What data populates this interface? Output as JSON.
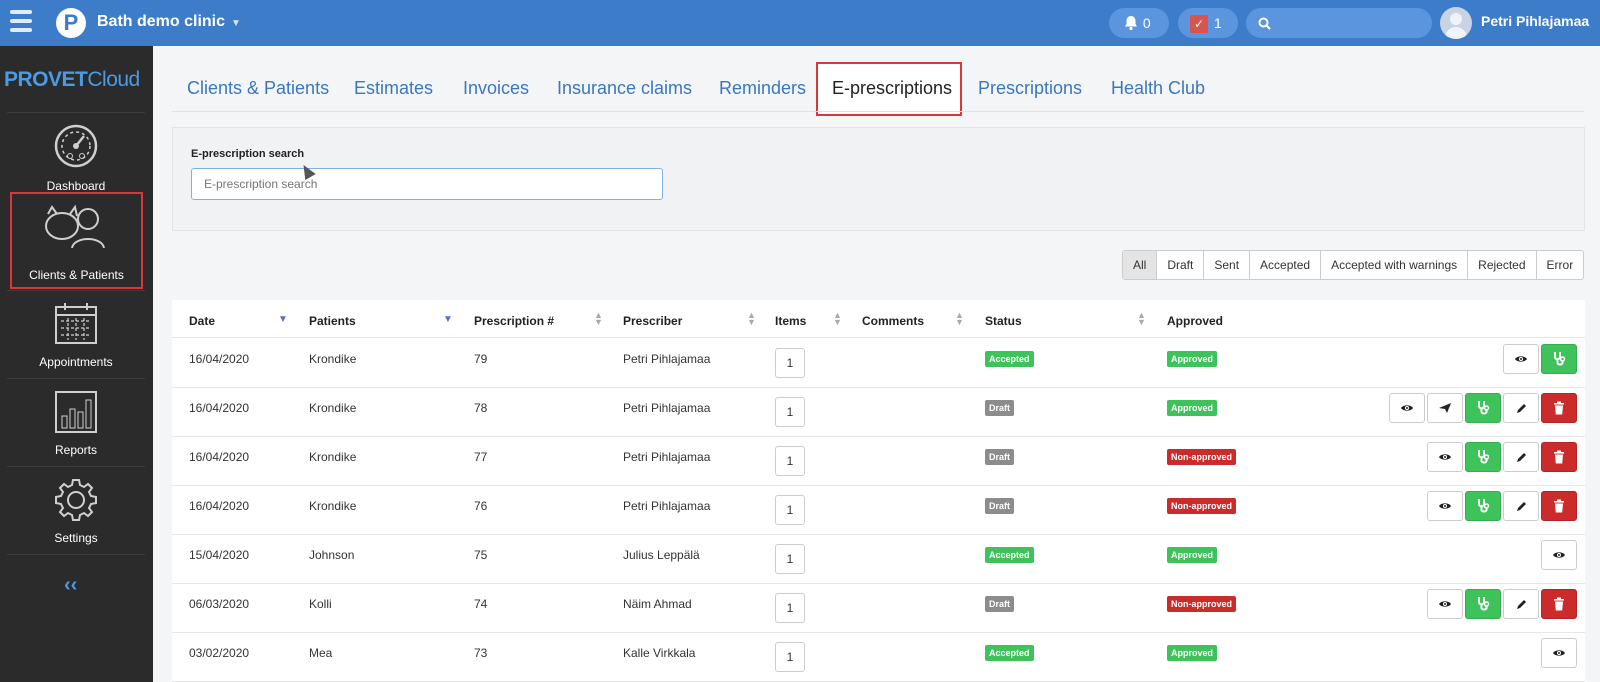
{
  "header": {
    "clinic_name": "Bath demo clinic",
    "notifications_count": "0",
    "tasks_count": "1",
    "user_name": "Petri Pihlajamaa"
  },
  "sidebar": {
    "brand_prefix": "PROVET",
    "brand_suffix": "Cloud",
    "items": [
      {
        "label": "Dashboard",
        "icon": "dashboard-gauge-icon"
      },
      {
        "label": "Clients & Patients",
        "icon": "clients-patients-icon",
        "highlighted": true
      },
      {
        "label": "Appointments",
        "icon": "calendar-icon"
      },
      {
        "label": "Reports",
        "icon": "bar-chart-icon"
      },
      {
        "label": "Settings",
        "icon": "gear-icon"
      }
    ],
    "collapse_label": "‹‹"
  },
  "tabs": [
    "Clients & Patients",
    "Estimates",
    "Invoices",
    "Insurance claims",
    "Reminders",
    "E-prescriptions",
    "Prescriptions",
    "Health Club"
  ],
  "active_tab": "E-prescriptions",
  "search": {
    "label": "E-prescription search",
    "placeholder": "E-prescription search"
  },
  "filters": [
    "All",
    "Draft",
    "Sent",
    "Accepted",
    "Accepted with warnings",
    "Rejected",
    "Error"
  ],
  "active_filter": "All",
  "table": {
    "columns": [
      "Date",
      "Patients",
      "Prescription #",
      "Prescriber",
      "Items",
      "Comments",
      "Status",
      "Approved"
    ],
    "rows": [
      {
        "date": "16/04/2020",
        "patient": "Krondike",
        "number": "79",
        "prescriber": "Petri Pihlajamaa",
        "items": "1",
        "comments": "",
        "status": "Accepted",
        "approved": "Approved",
        "actions": [
          "view",
          "stethoscope"
        ]
      },
      {
        "date": "16/04/2020",
        "patient": "Krondike",
        "number": "78",
        "prescriber": "Petri Pihlajamaa",
        "items": "1",
        "comments": "",
        "status": "Draft",
        "approved": "Approved",
        "actions": [
          "view",
          "send",
          "stethoscope",
          "edit",
          "delete"
        ]
      },
      {
        "date": "16/04/2020",
        "patient": "Krondike",
        "number": "77",
        "prescriber": "Petri Pihlajamaa",
        "items": "1",
        "comments": "",
        "status": "Draft",
        "approved": "Non-approved",
        "actions": [
          "view",
          "stethoscope",
          "edit",
          "delete"
        ]
      },
      {
        "date": "16/04/2020",
        "patient": "Krondike",
        "number": "76",
        "prescriber": "Petri Pihlajamaa",
        "items": "1",
        "comments": "",
        "status": "Draft",
        "approved": "Non-approved",
        "actions": [
          "view",
          "stethoscope",
          "edit",
          "delete"
        ]
      },
      {
        "date": "15/04/2020",
        "patient": "Johnson",
        "number": "75",
        "prescriber": "Julius Leppälä",
        "items": "1",
        "comments": "",
        "status": "Accepted",
        "approved": "Approved",
        "actions": [
          "view"
        ]
      },
      {
        "date": "06/03/2020",
        "patient": "Kolli",
        "number": "74",
        "prescriber": "Näim Ahmad",
        "items": "1",
        "comments": "",
        "status": "Draft",
        "approved": "Non-approved",
        "actions": [
          "view",
          "stethoscope",
          "edit",
          "delete"
        ]
      },
      {
        "date": "03/02/2020",
        "patient": "Mea",
        "number": "73",
        "prescriber": "Kalle Virkkala",
        "items": "1",
        "comments": "",
        "status": "Accepted",
        "approved": "Approved",
        "actions": [
          "view"
        ]
      }
    ]
  },
  "colors": {
    "topbar": "#3d7cc9",
    "sidebar": "#2b2b2b",
    "link": "#3a77bf",
    "accepted": "#3ec25a",
    "draft": "#8c8c8c",
    "non_approved": "#cc2b2b",
    "highlight_box": "#d9383a"
  }
}
